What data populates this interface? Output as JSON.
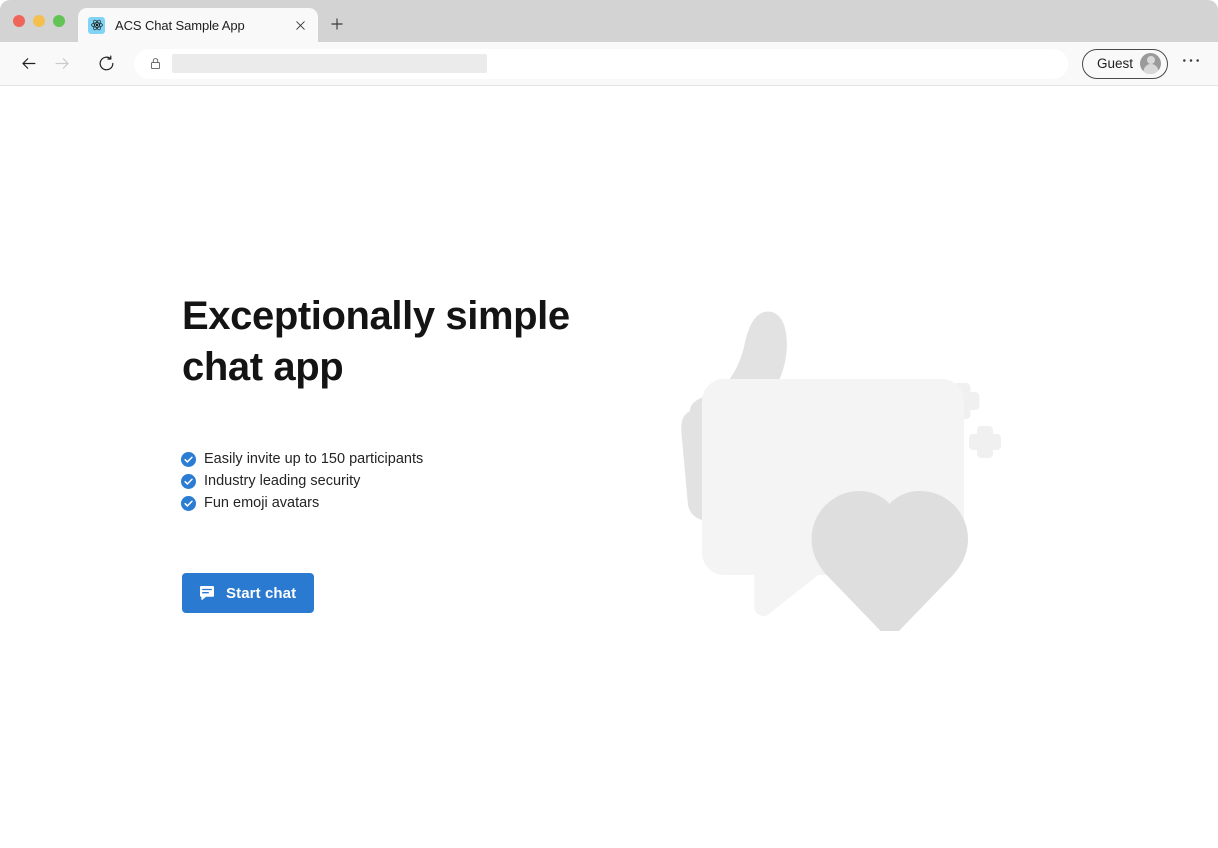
{
  "browser": {
    "traffic_lights": [
      {
        "name": "close",
        "color": "#f0655a"
      },
      {
        "name": "minimize",
        "color": "#f4bf4f"
      },
      {
        "name": "maximize",
        "color": "#61c454"
      }
    ],
    "tab": {
      "title": "ACS Chat Sample App",
      "favicon": "react-logo-icon",
      "favicon_bg": "#81d4f5",
      "close_icon": "close-icon"
    },
    "new_tab_icon": "plus-icon",
    "toolbar": {
      "back_icon": "back-arrow-icon",
      "forward_icon": "forward-arrow-icon",
      "reload_icon": "reload-icon",
      "lock_icon": "lock-icon",
      "url_value": "",
      "url_placeholder": "",
      "profile_label": "Guest",
      "profile_avatar_icon": "person-avatar-icon",
      "more_icon": "ellipsis-icon"
    }
  },
  "page": {
    "hero": {
      "title_line1": "Exceptionally simple",
      "title_line2": "chat app"
    },
    "features": [
      {
        "icon": "check-circle-icon",
        "label": "Easily invite up to 150 participants"
      },
      {
        "icon": "check-circle-icon",
        "label": "Industry leading security"
      },
      {
        "icon": "check-circle-icon",
        "label": "Fun emoji avatars"
      }
    ],
    "cta": {
      "icon": "chat-bubble-icon",
      "label": "Start chat",
      "color": "#2a7ad2"
    },
    "illustration": {
      "name": "chat-hero-illustration",
      "shapes": [
        "thumbs-up-icon",
        "speech-bubble-icon",
        "heart-icon",
        "sparkle-plus-icon",
        "sparkle-plus-icon",
        "sparkle-plus-icon"
      ],
      "base_color": "#e2e2e2",
      "bubble_color": "#f4f4f4"
    }
  },
  "colors": {
    "accent_blue": "#2a7ad2",
    "check_blue": "#2b7cd3",
    "text_primary": "#141414",
    "text_body": "#242424",
    "chrome_bg": "#d3d3d3",
    "toolbar_bg": "#f9f9f9"
  }
}
